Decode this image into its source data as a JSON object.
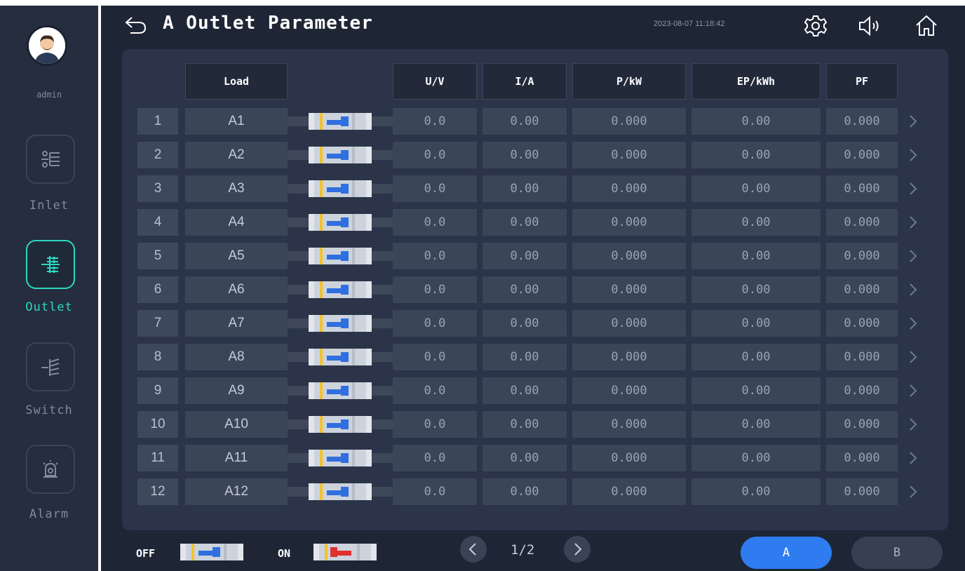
{
  "user": {
    "name": "admin"
  },
  "nav": [
    {
      "label": "Inlet",
      "icon": "inlet-icon",
      "active": false
    },
    {
      "label": "Outlet",
      "icon": "outlet-icon",
      "active": true
    },
    {
      "label": "Switch",
      "icon": "switch-icon",
      "active": false
    },
    {
      "label": "Alarm",
      "icon": "alarm-icon",
      "active": false
    }
  ],
  "header": {
    "title": "A Outlet Parameter",
    "datetime": "2023-08-07 11:18:42"
  },
  "table": {
    "columns": [
      "Load",
      "U/V",
      "I/A",
      "P/kW",
      "EP/kWh",
      "PF"
    ],
    "rows": [
      {
        "index": "1",
        "load": "A1",
        "switch_state": "off",
        "u": "0.0",
        "i": "0.00",
        "p": "0.000",
        "ep": "0.00",
        "pf": "0.000"
      },
      {
        "index": "2",
        "load": "A2",
        "switch_state": "off",
        "u": "0.0",
        "i": "0.00",
        "p": "0.000",
        "ep": "0.00",
        "pf": "0.000"
      },
      {
        "index": "3",
        "load": "A3",
        "switch_state": "off",
        "u": "0.0",
        "i": "0.00",
        "p": "0.000",
        "ep": "0.00",
        "pf": "0.000"
      },
      {
        "index": "4",
        "load": "A4",
        "switch_state": "off",
        "u": "0.0",
        "i": "0.00",
        "p": "0.000",
        "ep": "0.00",
        "pf": "0.000"
      },
      {
        "index": "5",
        "load": "A5",
        "switch_state": "off",
        "u": "0.0",
        "i": "0.00",
        "p": "0.000",
        "ep": "0.00",
        "pf": "0.000"
      },
      {
        "index": "6",
        "load": "A6",
        "switch_state": "off",
        "u": "0.0",
        "i": "0.00",
        "p": "0.000",
        "ep": "0.00",
        "pf": "0.000"
      },
      {
        "index": "7",
        "load": "A7",
        "switch_state": "off",
        "u": "0.0",
        "i": "0.00",
        "p": "0.000",
        "ep": "0.00",
        "pf": "0.000"
      },
      {
        "index": "8",
        "load": "A8",
        "switch_state": "off",
        "u": "0.0",
        "i": "0.00",
        "p": "0.000",
        "ep": "0.00",
        "pf": "0.000"
      },
      {
        "index": "9",
        "load": "A9",
        "switch_state": "off",
        "u": "0.0",
        "i": "0.00",
        "p": "0.000",
        "ep": "0.00",
        "pf": "0.000"
      },
      {
        "index": "10",
        "load": "A10",
        "switch_state": "off",
        "u": "0.0",
        "i": "0.00",
        "p": "0.000",
        "ep": "0.00",
        "pf": "0.000"
      },
      {
        "index": "11",
        "load": "A11",
        "switch_state": "off",
        "u": "0.0",
        "i": "0.00",
        "p": "0.000",
        "ep": "0.00",
        "pf": "0.000"
      },
      {
        "index": "12",
        "load": "A12",
        "switch_state": "off",
        "u": "0.0",
        "i": "0.00",
        "p": "0.000",
        "ep": "0.00",
        "pf": "0.000"
      }
    ]
  },
  "legend": {
    "off_label": "OFF",
    "on_label": "ON"
  },
  "pager": {
    "text": "1/2"
  },
  "tabs": [
    {
      "label": "A",
      "selected": true
    },
    {
      "label": "B",
      "selected": false
    }
  ],
  "colors": {
    "accent_teal": "#2bd9c0",
    "switch_off_handle": "#2f6fe0",
    "switch_on_handle": "#e0302f",
    "switch_rail": "#f2c230",
    "tab_selected": "#2f7cf0"
  }
}
